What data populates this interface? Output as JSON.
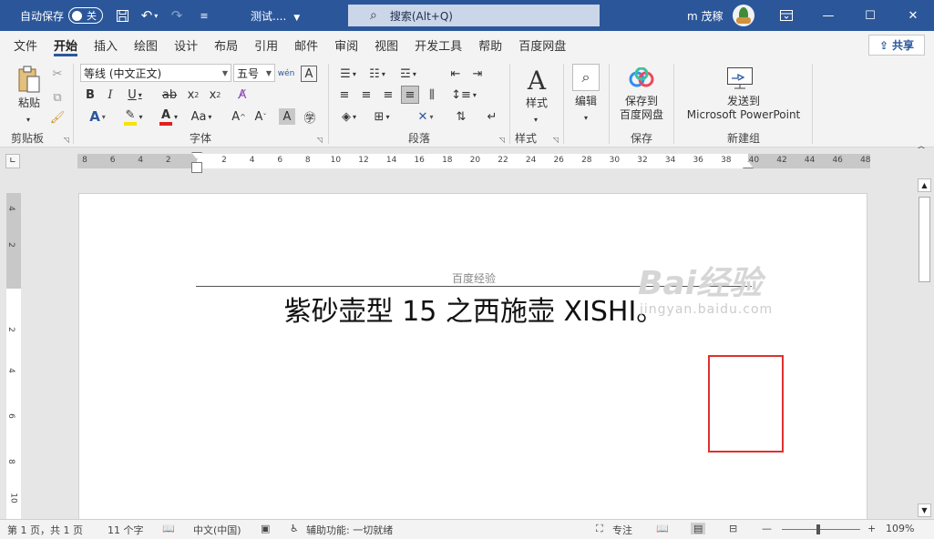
{
  "titlebar": {
    "autosave_label": "自动保存",
    "autosave_state": "关",
    "doc_title": "测试....",
    "search_placeholder": "搜索(Alt+Q)",
    "user_name": "m 茂稼",
    "bg_color": "#2b579a"
  },
  "menu": {
    "tabs": [
      "文件",
      "开始",
      "插入",
      "绘图",
      "设计",
      "布局",
      "引用",
      "邮件",
      "审阅",
      "视图",
      "开发工具",
      "帮助",
      "百度网盘"
    ],
    "active_index": 1,
    "share_label": "共享"
  },
  "ribbon": {
    "clipboard": {
      "paste_label": "粘贴",
      "group_label": "剪贴板"
    },
    "font": {
      "font_name": "等线 (中文正文)",
      "font_size": "五号",
      "group_label": "字体"
    },
    "paragraph": {
      "group_label": "段落"
    },
    "styles": {
      "label": "样式",
      "group_label": "样式"
    },
    "editing": {
      "label": "编辑"
    },
    "save": {
      "label_line1": "保存到",
      "label_line2": "百度网盘",
      "group_label": "保存"
    },
    "newgroup": {
      "label_line1": "发送到",
      "label_line2": "Microsoft PowerPoint",
      "group_label": "新建组"
    }
  },
  "ruler": {
    "h_ticks": [
      "8",
      "6",
      "4",
      "2",
      "2",
      "4",
      "6",
      "8",
      "10",
      "12",
      "14",
      "16",
      "18",
      "20",
      "22",
      "24",
      "26",
      "28",
      "30",
      "32",
      "34",
      "36",
      "38",
      "40",
      "42",
      "44",
      "46",
      "48"
    ],
    "v_ticks": [
      "4",
      "2",
      "2",
      "4",
      "6",
      "8",
      "10"
    ]
  },
  "document": {
    "header_text": "百度经验",
    "body_text": "紫砂壶型 15 之西施壶 XISHI。",
    "highlight_color": "#e03030"
  },
  "watermark": {
    "main": "Bai经验",
    "sub": "jingyan.baidu.com"
  },
  "statusbar": {
    "page": "第 1 页，共 1 页",
    "words": "11 个字",
    "language": "中文(中国)",
    "accessibility": "辅助功能: 一切就绪",
    "focus": "专注",
    "zoom": "109%"
  }
}
